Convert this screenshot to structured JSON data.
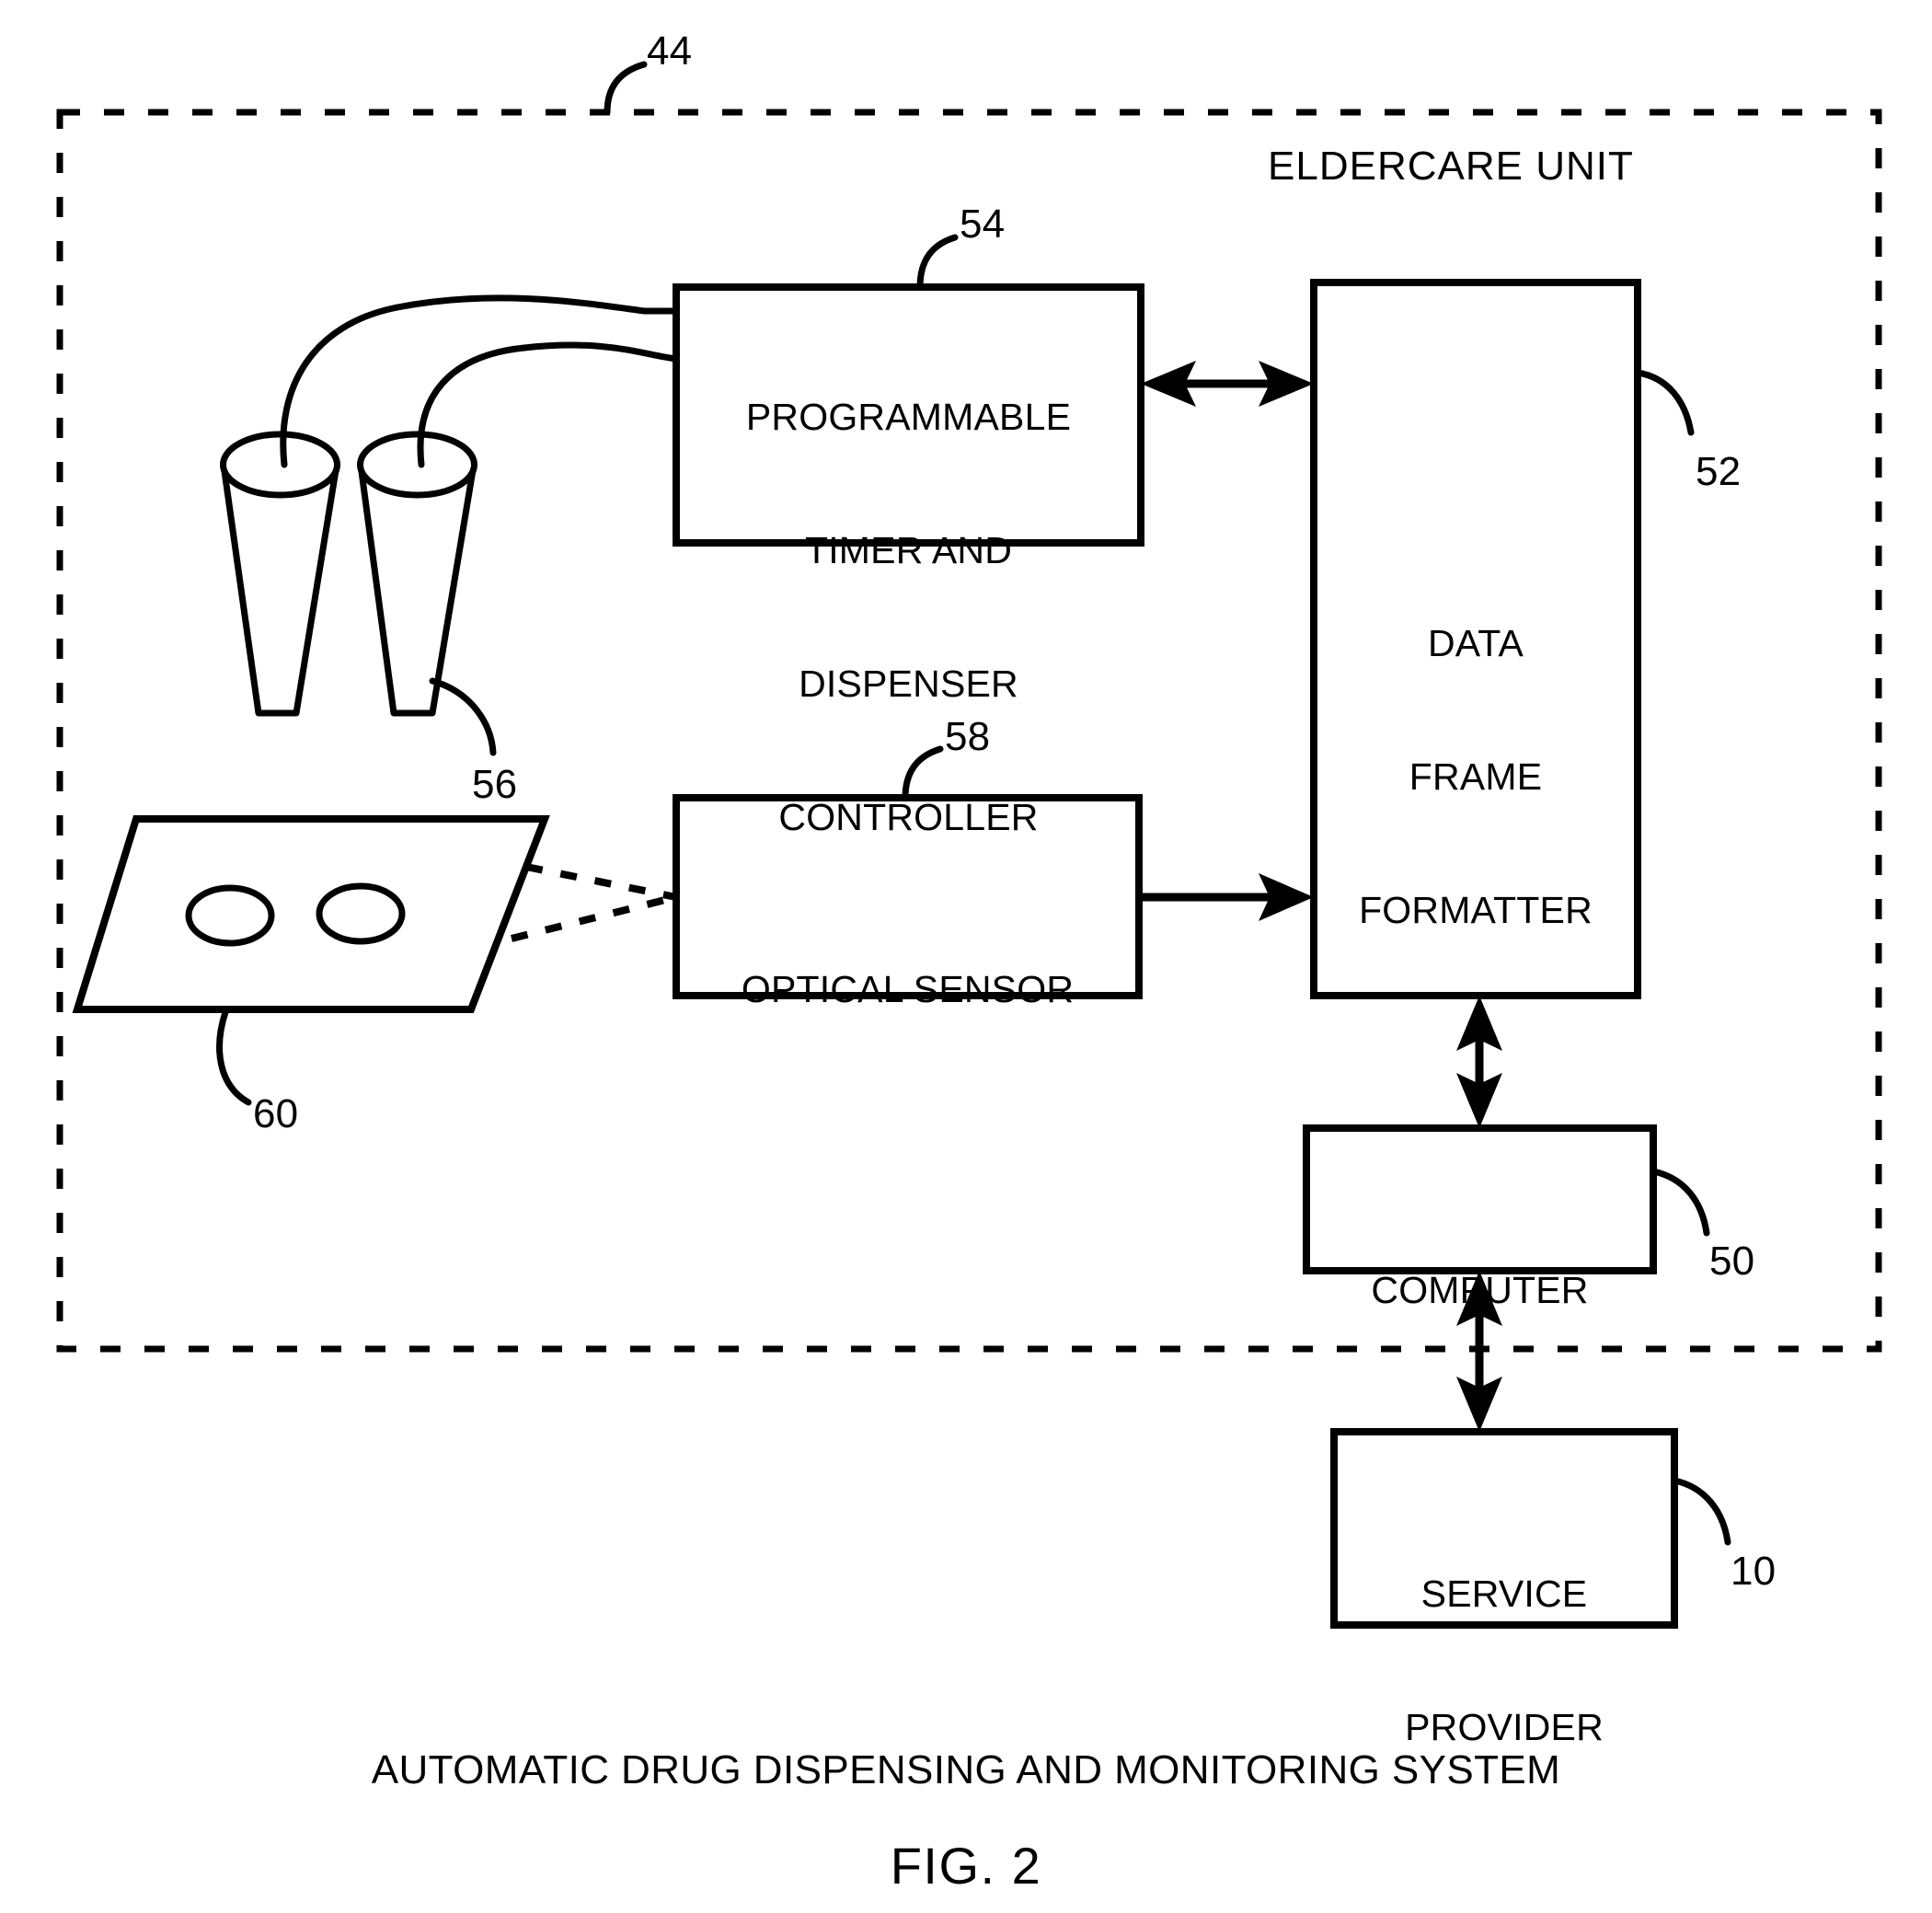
{
  "figure": {
    "number_label": "FIG. 2",
    "caption": "AUTOMATIC DRUG DISPENSING AND MONITORING SYSTEM"
  },
  "enclosure": {
    "title": "ELDERCARE UNIT",
    "reference_numeral": "44",
    "border_style": "dashed"
  },
  "blocks": [
    {
      "id": "programmable-timer-and-dispenser-controller",
      "lines": [
        "PROGRAMMABLE",
        "TIMER AND",
        "DISPENSER",
        "CONTROLLER"
      ],
      "reference_numeral": "54"
    },
    {
      "id": "data-frame-formatter",
      "lines": [
        "DATA",
        "FRAME",
        "FORMATTER"
      ],
      "reference_numeral": "52"
    },
    {
      "id": "optical-sensor",
      "lines": [
        "OPTICAL SENSOR"
      ],
      "reference_numeral": "58"
    },
    {
      "id": "computer",
      "lines": [
        "COMPUTER"
      ],
      "reference_numeral": "50"
    },
    {
      "id": "service-provider",
      "lines": [
        "SERVICE",
        "PROVIDER"
      ],
      "reference_numeral": "10"
    }
  ],
  "components": [
    {
      "id": "drug-dispenser-funnels",
      "name": "funnels",
      "reference_numeral": "56",
      "count": 2
    },
    {
      "id": "pill-tray",
      "name": "tray",
      "reference_numeral": "60",
      "pill_count": 2
    }
  ],
  "connections": [
    {
      "from": "programmable-timer-and-dispenser-controller",
      "to": "data-frame-formatter",
      "arrow": "bidirectional",
      "style": "solid"
    },
    {
      "from": "optical-sensor",
      "to": "data-frame-formatter",
      "arrow": "unidirectional",
      "style": "solid"
    },
    {
      "from": "data-frame-formatter",
      "to": "computer",
      "arrow": "bidirectional",
      "style": "solid"
    },
    {
      "from": "computer",
      "to": "service-provider",
      "arrow": "bidirectional",
      "style": "solid"
    },
    {
      "from": "pill-tray",
      "to": "optical-sensor",
      "arrow": "none",
      "style": "dashed"
    },
    {
      "from": "drug-dispenser-funnels",
      "to": "programmable-timer-and-dispenser-controller",
      "arrow": "none",
      "style": "curved-tube"
    }
  ],
  "colors": {
    "ink": "#000000",
    "background": "#ffffff"
  }
}
